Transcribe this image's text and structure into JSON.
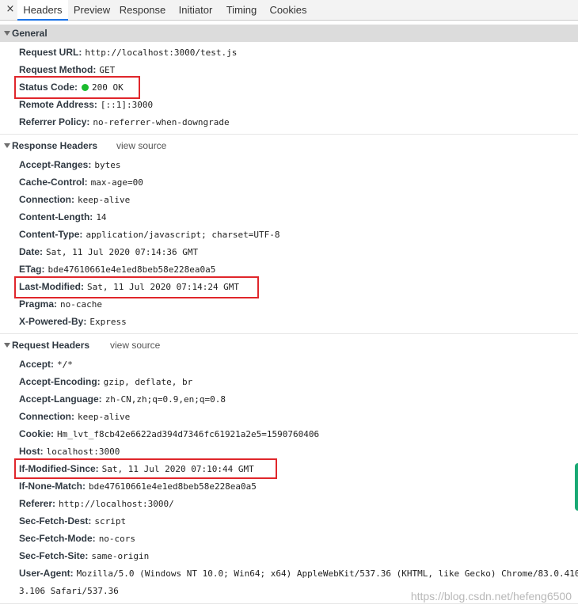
{
  "tabs": [
    {
      "label": "Headers"
    },
    {
      "label": "Preview"
    },
    {
      "label": "Response"
    },
    {
      "label": "Initiator"
    },
    {
      "label": "Timing"
    },
    {
      "label": "Cookies"
    }
  ],
  "close_glyph": "×",
  "general": {
    "title": "General",
    "rows": [
      {
        "key": "Request URL:",
        "value": "http://localhost:3000/test.js"
      },
      {
        "key": "Request Method:",
        "value": "GET"
      },
      {
        "key": "Status Code:",
        "value": "200 OK"
      },
      {
        "key": "Remote Address:",
        "value": "[::1]:3000"
      },
      {
        "key": "Referrer Policy:",
        "value": "no-referrer-when-downgrade"
      }
    ]
  },
  "response_headers": {
    "title": "Response Headers",
    "view_source": "view source",
    "rows": [
      {
        "key": "Accept-Ranges:",
        "value": "bytes"
      },
      {
        "key": "Cache-Control:",
        "value": "max-age=00"
      },
      {
        "key": "Connection:",
        "value": "keep-alive"
      },
      {
        "key": "Content-Length:",
        "value": "14"
      },
      {
        "key": "Content-Type:",
        "value": "application/javascript; charset=UTF-8"
      },
      {
        "key": "Date:",
        "value": "Sat, 11 Jul 2020 07:14:36 GMT"
      },
      {
        "key": "ETag:",
        "value": "bde47610661e4e1ed8beb58e228ea0a5"
      },
      {
        "key": "Last-Modified:",
        "value": "Sat, 11 Jul 2020 07:14:24 GMT"
      },
      {
        "key": "Pragma:",
        "value": "no-cache"
      },
      {
        "key": "X-Powered-By:",
        "value": "Express"
      }
    ]
  },
  "request_headers": {
    "title": "Request Headers",
    "view_source": "view source",
    "rows": [
      {
        "key": "Accept:",
        "value": "*/*"
      },
      {
        "key": "Accept-Encoding:",
        "value": "gzip, deflate, br"
      },
      {
        "key": "Accept-Language:",
        "value": "zh-CN,zh;q=0.9,en;q=0.8"
      },
      {
        "key": "Connection:",
        "value": "keep-alive"
      },
      {
        "key": "Cookie:",
        "value": "Hm_lvt_f8cb42e6622ad394d7346fc61921a2e5=1590760406"
      },
      {
        "key": "Host:",
        "value": "localhost:3000"
      },
      {
        "key": "If-Modified-Since:",
        "value": "Sat, 11 Jul 2020 07:10:44 GMT"
      },
      {
        "key": "If-None-Match:",
        "value": "bde47610661e4e1ed8beb58e228ea0a5"
      },
      {
        "key": "Referer:",
        "value": "http://localhost:3000/"
      },
      {
        "key": "Sec-Fetch-Dest:",
        "value": "script"
      },
      {
        "key": "Sec-Fetch-Mode:",
        "value": "no-cors"
      },
      {
        "key": "Sec-Fetch-Site:",
        "value": "same-origin"
      },
      {
        "key": "User-Agent:",
        "value": "Mozilla/5.0 (Windows NT 10.0; Win64; x64) AppleWebKit/537.36 (KHTML, like Gecko) Chrome/83.0.410"
      },
      {
        "key": "",
        "value": "3.106 Safari/537.36"
      }
    ]
  },
  "watermark": "https://blog.csdn.net/hefeng6500",
  "colors": {
    "status_ok": "#1bbb2e",
    "highlight": "#e0262b",
    "active_tab": "#1a73e8"
  }
}
